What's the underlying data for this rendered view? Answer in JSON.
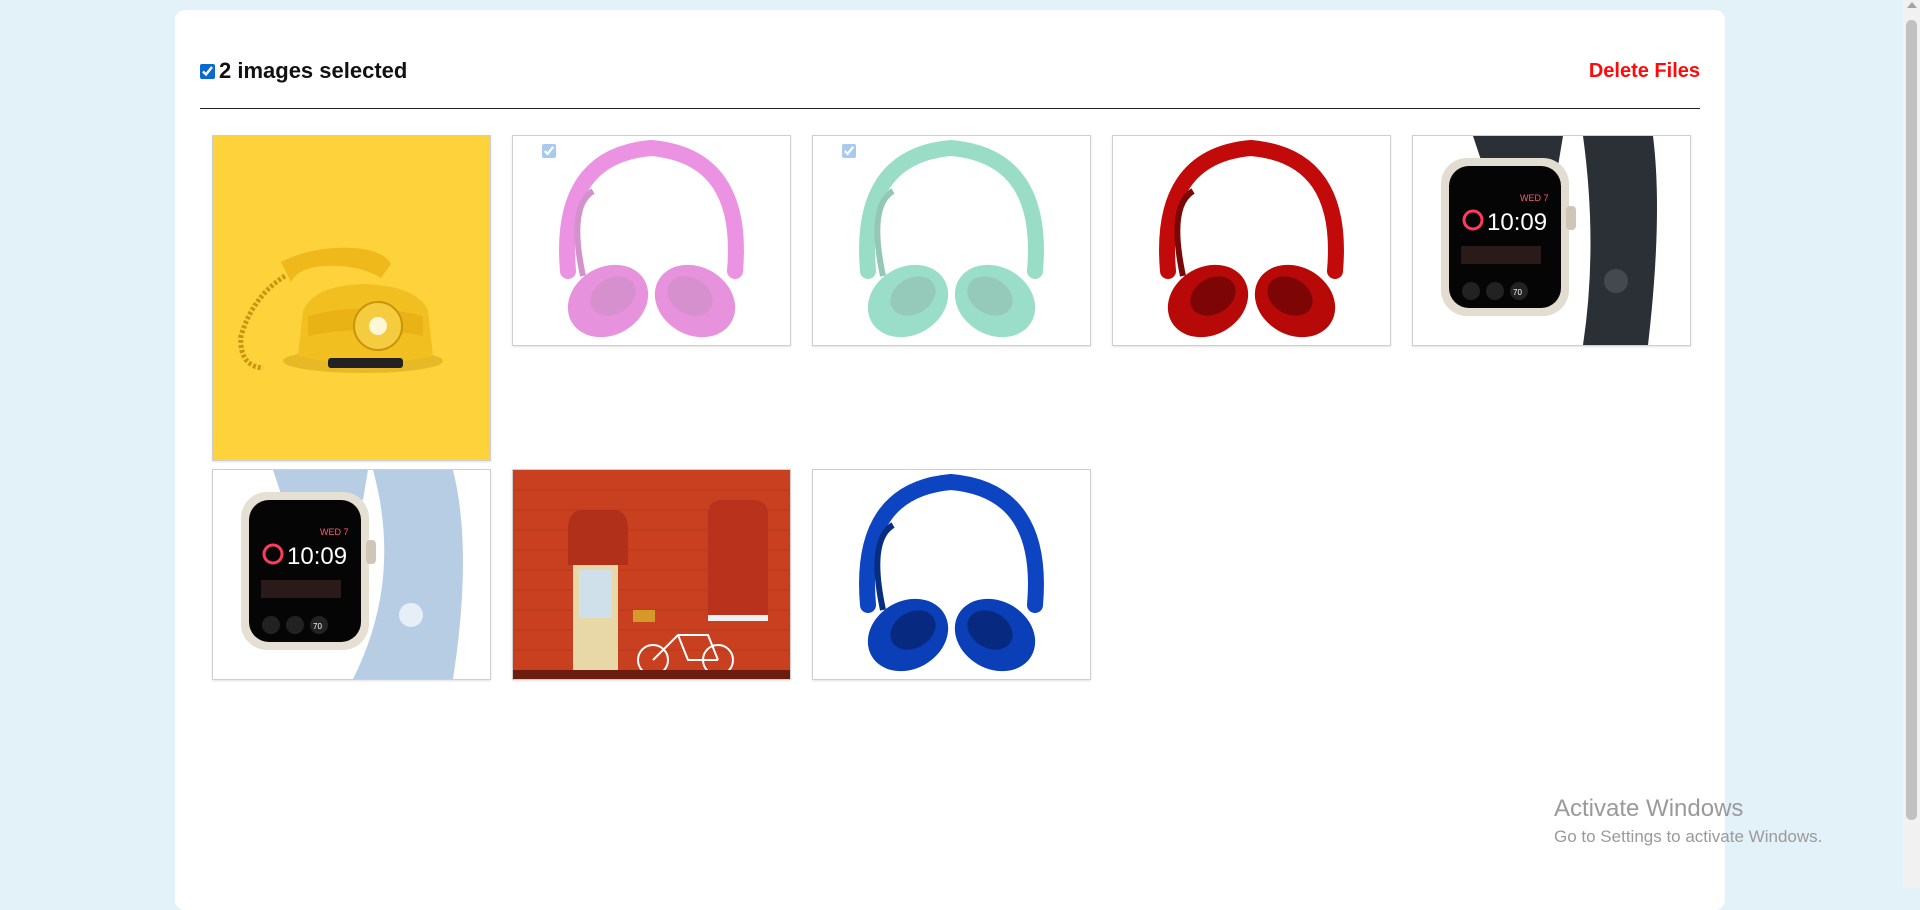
{
  "header": {
    "selected_label": "2 images selected",
    "delete_label": "Delete Files",
    "delete_color": "#ff0a0a"
  },
  "gallery": [
    {
      "name": "yellow-telephone-image",
      "selected": false
    },
    {
      "name": "pink-headphones-image",
      "selected": true
    },
    {
      "name": "mint-headphones-image",
      "selected": true
    },
    {
      "name": "red-headphones-image",
      "selected": false
    },
    {
      "name": "black-smartwatch-image",
      "selected": false
    },
    {
      "name": "blue-smartwatch-image",
      "selected": false
    },
    {
      "name": "red-brick-wall-bicycle-image",
      "selected": false
    },
    {
      "name": "blue-headphones-image",
      "selected": false
    }
  ],
  "watch_face": {
    "time": "10:09",
    "date": "WED 7",
    "ring_value": "70"
  },
  "watermark": {
    "line1": "Activate Windows",
    "line2": "Go to Settings to activate Windows."
  }
}
